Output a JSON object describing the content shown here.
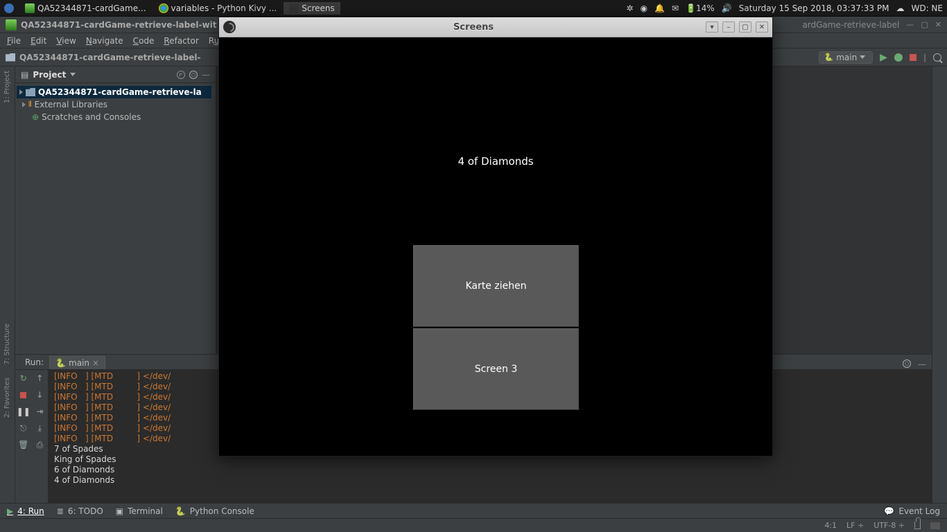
{
  "panel": {
    "tasks": [
      {
        "label": "QA52344871-cardGame..."
      },
      {
        "label": "variables - Python Kivy ..."
      },
      {
        "label": "Screens"
      }
    ],
    "battery": "14%",
    "clock": "Saturday 15 Sep 2018, 03:37:33 PM",
    "wd": "WD: NE"
  },
  "pycharm": {
    "title": "QA52344871-cardGame-retrieve-label-wit",
    "title_right": "ardGame-retrieve-label",
    "menus": [
      "File",
      "Edit",
      "View",
      "Navigate",
      "Code",
      "Refactor",
      "Ru"
    ],
    "breadcrumb": "QA52344871-cardGame-retrieve-label-",
    "runconfig": "main",
    "project": {
      "title": "Project",
      "items": [
        "QA52344871-cardGame-retrieve-la",
        "External Libraries",
        "Scratches and Consoles"
      ]
    },
    "run": {
      "label": "Run:",
      "tab": "main",
      "lines": [
        "[INFO   ] [MTD         ] </dev/",
        "[INFO   ] [MTD         ] </dev/",
        "[INFO   ] [MTD         ] </dev/",
        "[INFO   ] [MTD         ] </dev/",
        "[INFO   ] [MTD         ] </dev/",
        "[INFO   ] [MTD         ] </dev/",
        "[INFO   ] [MTD         ] </dev/"
      ],
      "cards": [
        "7 of Spades",
        "King of Spades",
        "6 of Diamonds",
        "4 of Diamonds"
      ]
    },
    "toolstrip": {
      "run": "4: Run",
      "todo": "6: TODO",
      "terminal": "Terminal",
      "pyconsole": "Python Console",
      "eventlog": "Event Log"
    },
    "status": {
      "pos": "4:1",
      "le": "LF",
      "enc": "UTF-8"
    },
    "side_labels": {
      "project": "1: Project",
      "structure": "7: Structure",
      "favorites": "2: Favorites"
    }
  },
  "kivy": {
    "title": "Screens",
    "card": "4 of Diamonds",
    "btn1": "Karte ziehen",
    "btn2": "Screen 3"
  }
}
